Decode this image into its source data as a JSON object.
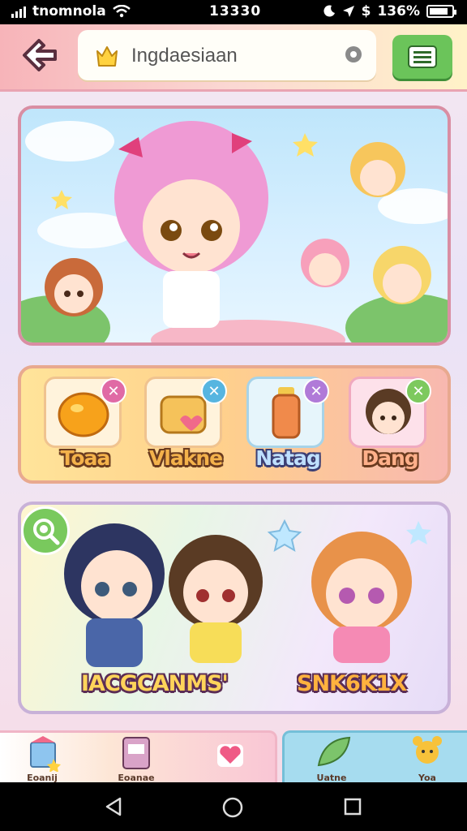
{
  "status_bar": {
    "carrier": "tnomnola",
    "time": "13330",
    "battery": "136%",
    "battery_level": 0.85
  },
  "header": {
    "search_text": "Ingdaesiaan"
  },
  "items": [
    {
      "label": "Toaa",
      "badge": "✕",
      "badge_color": "#e06aa5"
    },
    {
      "label": "Vlakne",
      "badge": "✕",
      "badge_color": "#56b5e0"
    },
    {
      "label": "Natag",
      "badge": "✕",
      "badge_color": "#b07ad8"
    },
    {
      "label": "Dang",
      "badge": "✕",
      "badge_color": "#7dc95e"
    }
  ],
  "characters": {
    "left_label": "IACGCANMS'",
    "right_label": "SNK6K1X"
  },
  "tabs": [
    {
      "label": "Eoanij"
    },
    {
      "label": "Eoanae"
    },
    {
      "label": "Uatne"
    },
    {
      "label": "Yoa"
    }
  ],
  "colors": {
    "accent_green": "#6bc45a",
    "header_pink": "#f7b4b9",
    "label_orange": "#f4b24b"
  }
}
